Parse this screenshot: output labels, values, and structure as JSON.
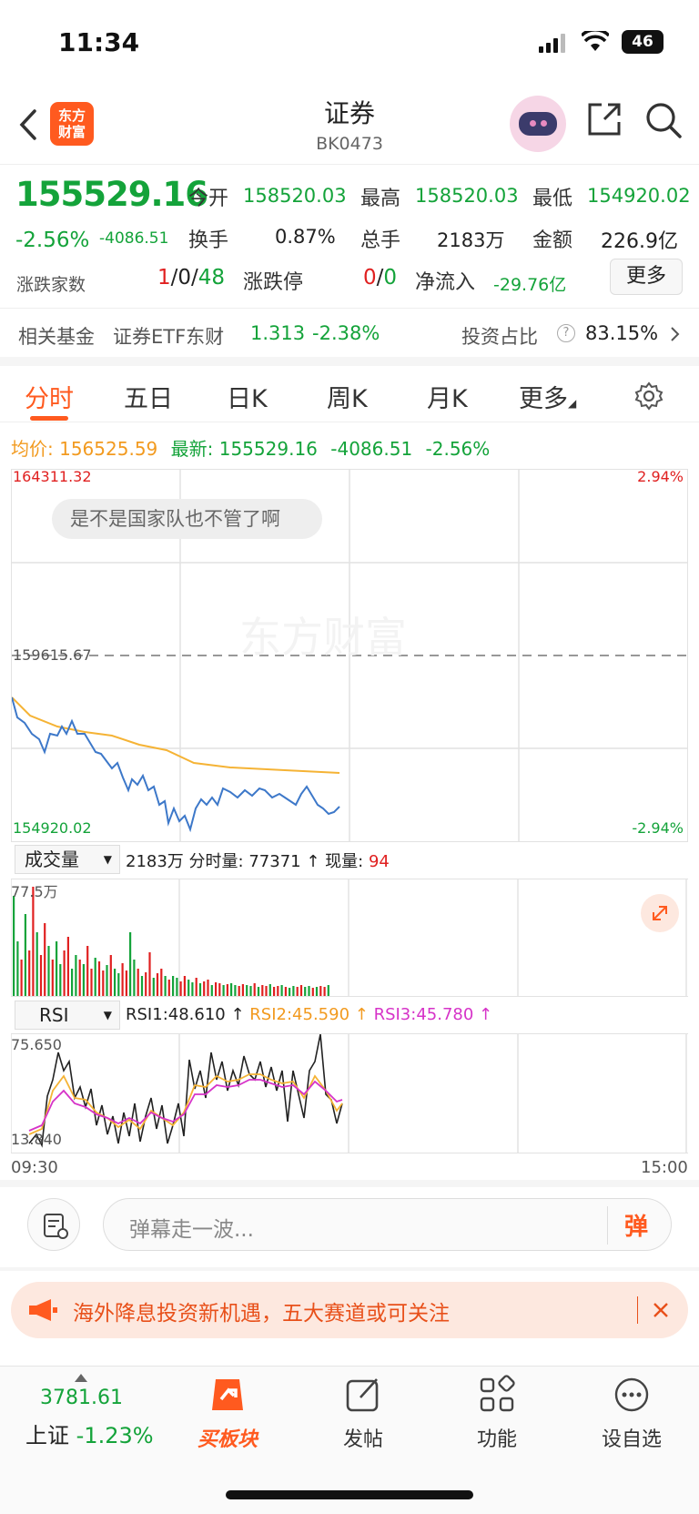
{
  "status": {
    "time": "11:34",
    "battery": "46"
  },
  "header": {
    "title": "证券",
    "code": "BK0473",
    "logo_line1": "东方",
    "logo_line2": "财富"
  },
  "quote": {
    "price": "155529.16",
    "change_pct": "-2.56%",
    "change": "-4086.51",
    "open_label": "今开",
    "open": "158520.03",
    "high_label": "最高",
    "high": "158520.03",
    "low_label": "最低",
    "low": "154920.02",
    "turnover_label": "换手",
    "turnover": "0.87%",
    "volume_label": "总手",
    "volume": "2183万",
    "amount_label": "金额",
    "amount": "226.9亿",
    "breadth_label": "涨跌家数",
    "breadth_up": "1",
    "breadth_flat": "0",
    "breadth_down": "48",
    "limit_label": "涨跌停",
    "limit_up": "0",
    "limit_down": "0",
    "inflow_label": "净流入",
    "inflow": "-29.76亿",
    "more": "更多"
  },
  "fund": {
    "label": "相关基金",
    "name": "证券ETF东财",
    "price": "1.313",
    "change": "-2.38%",
    "ratio_label": "投资占比",
    "ratio": "83.15%"
  },
  "tabs": [
    "分时",
    "五日",
    "日K",
    "周K",
    "月K",
    "更多"
  ],
  "intraday": {
    "avg_label": "均价:",
    "avg": "156525.59",
    "last_label": "最新:",
    "last": "155529.16",
    "last_change": "-4086.51",
    "last_pct": "-2.56%",
    "y_top": "164311.32",
    "y_mid": "159615.67",
    "y_bottom": "154920.02",
    "pct_top": "2.94%",
    "pct_bottom": "-2.94%",
    "bubble": "是不是国家队也不管了啊",
    "watermark": "东方财富"
  },
  "volume": {
    "select": "成交量",
    "total": "2183万",
    "minute_label": "分时量:",
    "minute": "77371",
    "now_label": "现量:",
    "now": "94",
    "ymax": "77.5万"
  },
  "rsi": {
    "select": "RSI",
    "rsi1": "RSI1:48.610",
    "rsi2": "RSI2:45.590",
    "rsi3": "RSI3:45.780",
    "ytop": "75.650",
    "ybottom": "13.840",
    "x_start": "09:30",
    "x_end": "15:00"
  },
  "comment": {
    "placeholder": "弹幕走一波...",
    "danmu": "弹"
  },
  "promo": {
    "text": "海外降息投资新机遇，五大赛道或可关注"
  },
  "nav": {
    "index_value": "3781.61",
    "index_name": "上证",
    "index_pct": "-1.23%",
    "items": [
      "买板块",
      "发帖",
      "功能",
      "设自选"
    ]
  },
  "colors": {
    "up": "#e02020",
    "down": "#14a33a",
    "accent": "#ff5a1f",
    "avg": "#f5b335",
    "line": "#3d78c9"
  }
}
